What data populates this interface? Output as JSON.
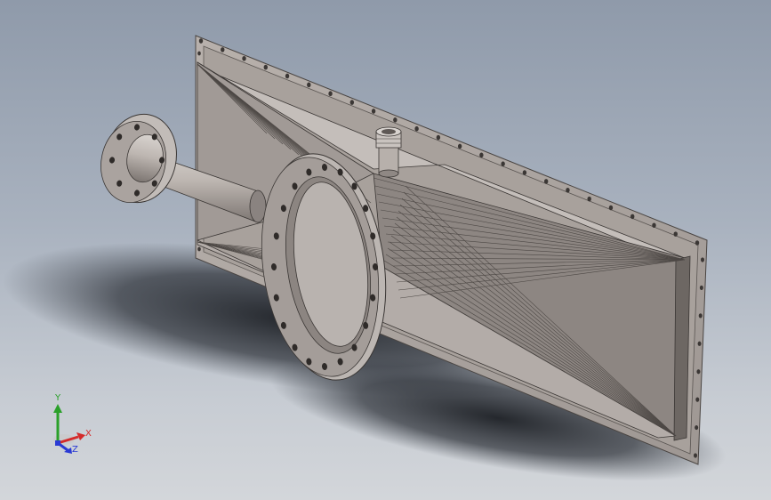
{
  "viewport": {
    "background_top": "#8f9aaa",
    "background_bottom": "#d3d6da"
  },
  "model": {
    "part_color": "#b0a9a4",
    "part_shadow_color": "#7f7874",
    "edge_color": "#3a3634"
  },
  "triad": {
    "x_label": "X",
    "y_label": "Y",
    "z_label": "Z",
    "x_color": "#d42a2a",
    "y_color": "#2aa02a",
    "z_color": "#2a3ad4"
  }
}
